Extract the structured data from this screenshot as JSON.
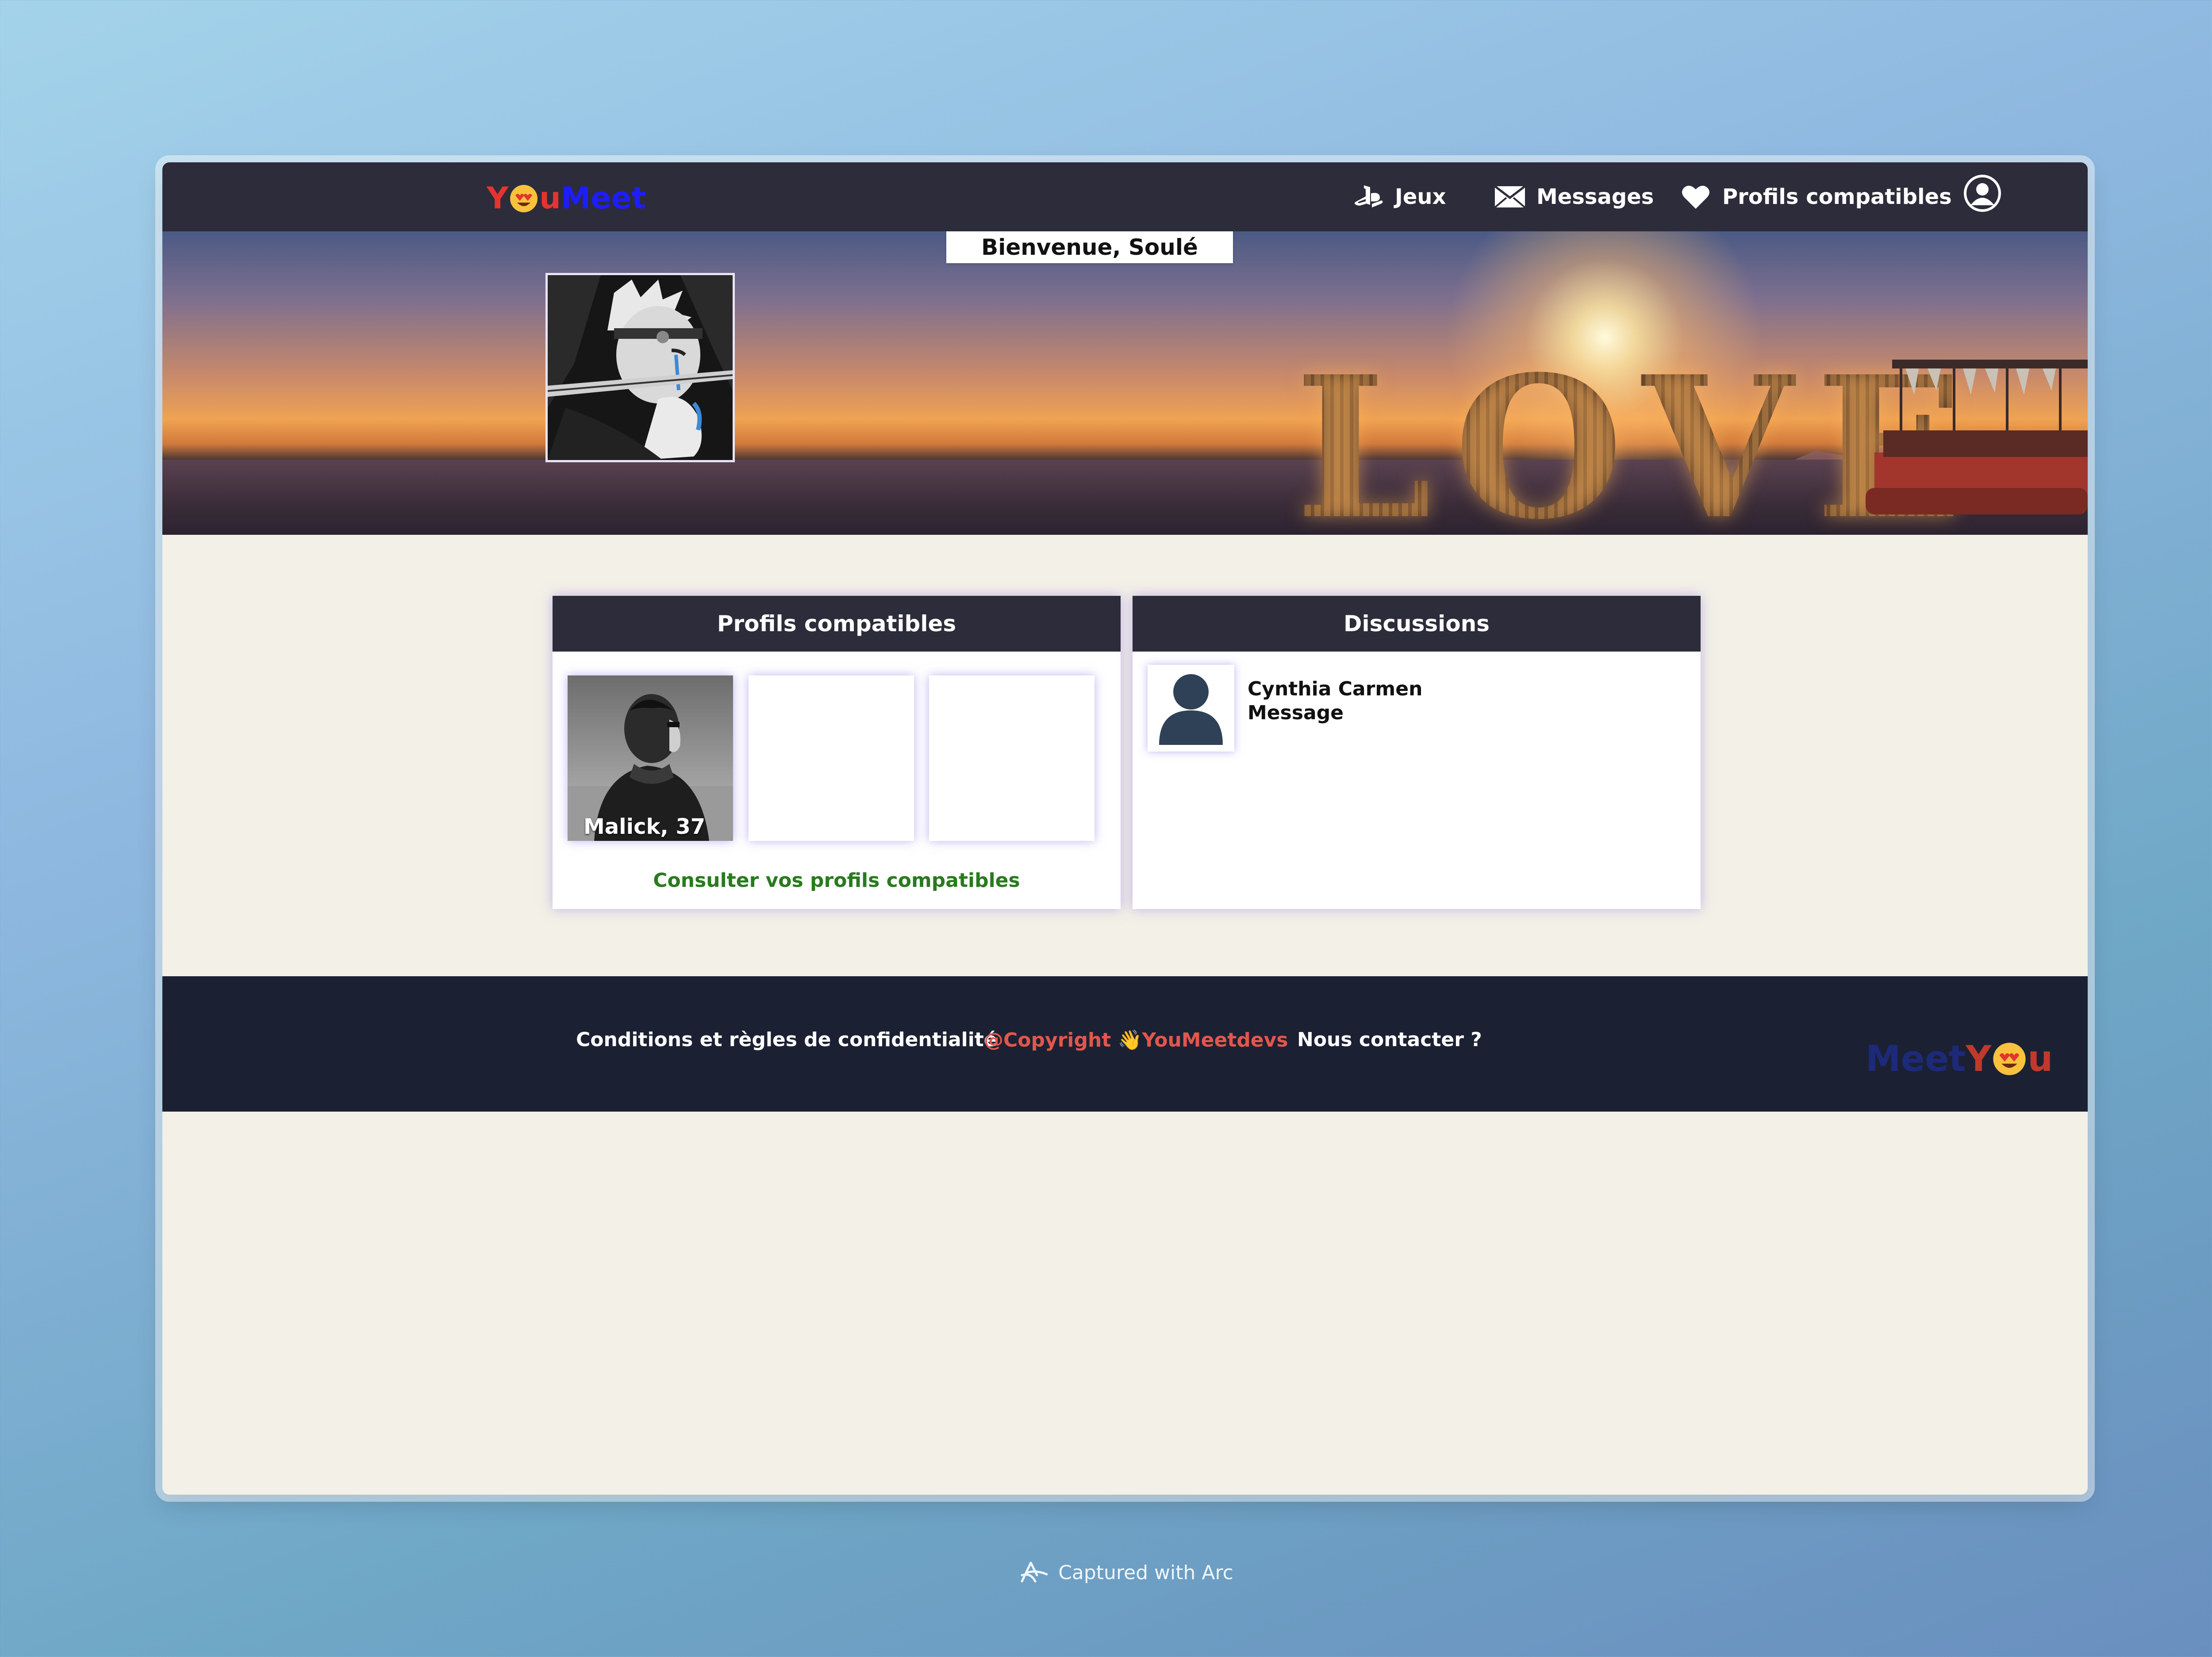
{
  "nav": {
    "logo": {
      "part1": "Y",
      "part2": "u",
      "part3": "Meet"
    },
    "items": [
      {
        "label": "Jeux",
        "icon": "playstation-icon"
      },
      {
        "label": "Messages",
        "icon": "envelope-icon"
      },
      {
        "label": "Profils compatibles",
        "icon": "heart-icon"
      }
    ],
    "user_icon": "user-circle-icon"
  },
  "banner": {
    "welcome": "Bienvenue, Soulé",
    "sign_text": "LOVE"
  },
  "compatible_profiles": {
    "title": "Profils compatibles",
    "profiles": [
      {
        "label": "Malick, 37"
      },
      {
        "label": ""
      },
      {
        "label": ""
      }
    ],
    "link": "Consulter vos profils compatibles"
  },
  "discussions": {
    "title": "Discussions",
    "items": [
      {
        "name": "Cynthia Carmen",
        "preview": "Message"
      }
    ]
  },
  "footer": {
    "conditions": "Conditions et règles de confidentialité",
    "copyright": "@Copyright 👋YouMeetdevs",
    "contact": "Nous contacter ?",
    "logo": {
      "part1": "Meet",
      "part2": "Y",
      "part3": "u"
    }
  },
  "capture_note": "Captured with Arc",
  "colors": {
    "navbar": "#2d2c3a",
    "footer": "#1b2133",
    "page_bg": "#f3f0e7",
    "link_green": "#2a7a1f",
    "copyright_red": "#e2564d",
    "logo_red": "#e3342f",
    "logo_blue": "#1d1dff"
  }
}
